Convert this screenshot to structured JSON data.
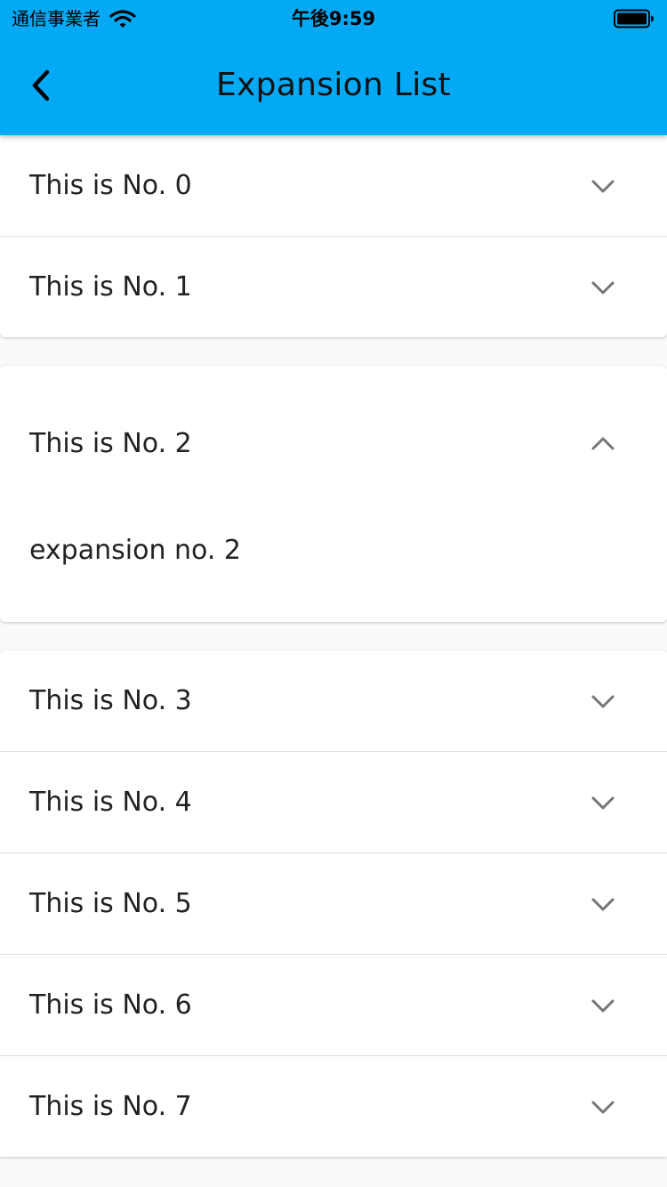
{
  "status_bar": {
    "carrier": "通信事業者",
    "time": "午後9:59"
  },
  "app_bar": {
    "title": "Expansion List",
    "back_icon": "chevron-left-icon"
  },
  "panels": [
    {
      "label": "This is No. 0",
      "expanded": false
    },
    {
      "label": "This is No. 1",
      "expanded": false
    },
    {
      "label": "This is No. 2",
      "expanded": true,
      "body": "expansion no. 2"
    },
    {
      "label": "This is No. 3",
      "expanded": false
    },
    {
      "label": "This is No. 4",
      "expanded": false
    },
    {
      "label": "This is No. 5",
      "expanded": false
    },
    {
      "label": "This is No. 6",
      "expanded": false
    },
    {
      "label": "This is No. 7",
      "expanded": false
    }
  ],
  "icons": {
    "collapsed": "chevron-down-icon",
    "expanded": "chevron-up-icon"
  },
  "colors": {
    "app_bar": "#03a9f4",
    "background": "#fafafa",
    "panel": "#ffffff",
    "chevron": "#757575"
  }
}
